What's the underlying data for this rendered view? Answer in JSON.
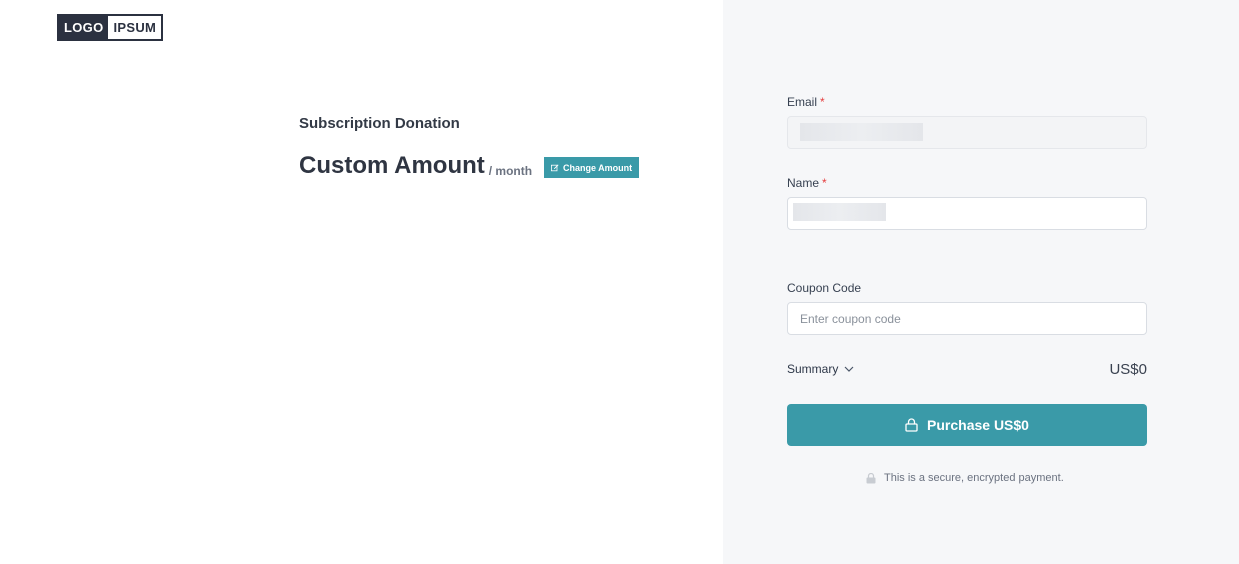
{
  "logo": {
    "part1": "LOGO",
    "part2": "IPSUM"
  },
  "product": {
    "subtitle": "Subscription Donation",
    "amount_label": "Custom Amount",
    "period": "/ month",
    "change_button": "Change Amount"
  },
  "form": {
    "email_label": "Email",
    "name_label": "Name",
    "required_marker": "*",
    "coupon_label": "Coupon Code",
    "coupon_placeholder": "Enter coupon code"
  },
  "summary": {
    "label": "Summary",
    "total": "US$0"
  },
  "purchase_button": "Purchase US$0",
  "secure_note": "This is a secure, encrypted payment.",
  "colors": {
    "accent": "#3a9aa8",
    "right_panel": "#f6f7f9",
    "logo_dark": "#2b3140",
    "required": "#e53e3e"
  },
  "icons": {
    "change": "edit-icon",
    "summary": "chevron-down-icon",
    "purchase": "lock-icon",
    "secure": "lock-icon"
  }
}
